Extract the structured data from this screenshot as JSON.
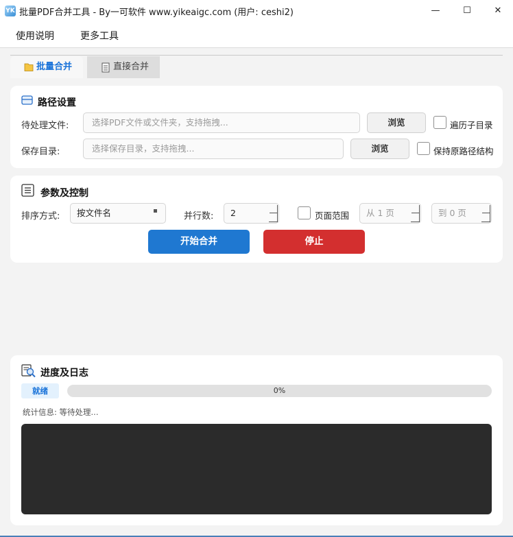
{
  "window": {
    "title": "批量PDF合并工具 - By一可软件 www.yikeaigc.com (用户: ceshi2)",
    "icon_letter": "YK",
    "minimize_glyph": "—",
    "maximize_glyph": "☐",
    "close_glyph": "✕"
  },
  "menu": [
    "使用说明",
    "更多工具"
  ],
  "tabs": [
    {
      "label": "批量合并",
      "icon": "folder-icon",
      "active": true
    },
    {
      "label": "直接合并",
      "icon": "document-icon",
      "active": false
    }
  ],
  "path_settings": {
    "title": "路径设置",
    "source": {
      "label": "待处理文件:",
      "placeholder": "选择PDF文件或文件夹，支持拖拽...",
      "browse": "浏览",
      "checkbox_label": "遍历子目录",
      "checked": false
    },
    "output": {
      "label": "保存目录:",
      "placeholder": "选择保存目录，支持拖拽...",
      "browse": "浏览",
      "checkbox_label": "保持原路径结构",
      "checked": false
    }
  },
  "params": {
    "title": "参数及控制",
    "sort_label": "排序方式:",
    "sort_value": "按文件名",
    "parallel_label": "并行数:",
    "parallel_value": "2",
    "page_range_label": "页面范围",
    "page_range_checked": false,
    "from_page": "从 1 页",
    "to_page": "到 0 页",
    "start_button": "开始合并",
    "stop_button": "停止",
    "start_color": "#1f78d1",
    "stop_color": "#d32f2f"
  },
  "log": {
    "title": "进度及日志",
    "status": "就绪",
    "progress": 0,
    "progress_text": "0%",
    "stats": "统计信息: 等待处理..."
  }
}
